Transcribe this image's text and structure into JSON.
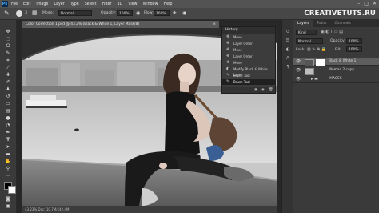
{
  "app": {
    "logo": "Ps"
  },
  "menubar": {
    "items": [
      "File",
      "Edit",
      "Image",
      "Layer",
      "Type",
      "Select",
      "Filter",
      "3D",
      "View",
      "Window",
      "Help"
    ],
    "controls": [
      "–",
      "□",
      "✕"
    ]
  },
  "watermark": "CREATIVETUTS.RU",
  "options": {
    "brush_size": "3",
    "mode_label": "Mode:",
    "mode_value": "Normal",
    "opacity_label": "Opacity:",
    "opacity_value": "100%",
    "flow_label": "Flow:",
    "flow_value": "100%"
  },
  "document": {
    "tab_title": "Color Correction 1.psd @ 43.2% (Black & White 1, Layer Mask/8)",
    "close": "×",
    "status": "43.23%   Doc: 10.7M/142.4M"
  },
  "history": {
    "title": "History",
    "items": [
      {
        "label": "Move",
        "icon": "move-icon",
        "glyph": "✥"
      },
      {
        "label": "Layer Order",
        "icon": "move-icon",
        "glyph": "✥"
      },
      {
        "label": "Move",
        "icon": "move-icon",
        "glyph": "✥"
      },
      {
        "label": "Layer Order",
        "icon": "move-icon",
        "glyph": "✥"
      },
      {
        "label": "Move",
        "icon": "move-icon",
        "glyph": "✥"
      },
      {
        "label": "Modify Black & White Layer",
        "icon": "adjustment-icon",
        "glyph": "◐"
      },
      {
        "label": "Brush Tool",
        "icon": "brush-icon",
        "glyph": "✎"
      },
      {
        "label": "Brush Tool",
        "icon": "brush-icon",
        "glyph": "✎"
      }
    ],
    "active_index": 7
  },
  "layers": {
    "tabs": [
      "Layers",
      "Paths",
      "Channels"
    ],
    "active_tab": 0,
    "kind_value": "Kind",
    "blend_value": "Normal",
    "opacity_label": "Opacity:",
    "opacity_value": "100%",
    "lock_label": "Lock:",
    "fill_label": "Fill:",
    "fill_value": "100%",
    "rows": [
      {
        "name": "Black & White 1",
        "selected": true
      },
      {
        "name": "Woman 2 copy",
        "selected": false
      },
      {
        "name": "IMAGES",
        "selected": false
      }
    ]
  },
  "colors": {
    "accent": "#2d8ceb",
    "foreground_swatch": "#000000",
    "background_swatch": "#ffffff"
  }
}
